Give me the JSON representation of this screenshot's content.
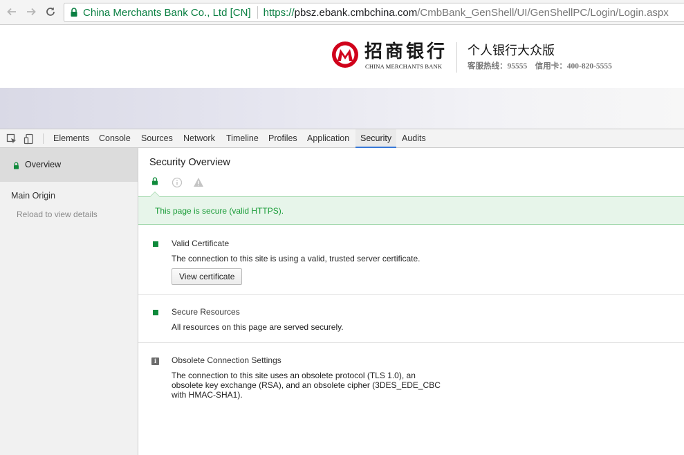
{
  "browser": {
    "nav": {
      "back_icon": "arrow-left-icon",
      "forward_icon": "arrow-right-icon",
      "reload_icon": "reload-icon"
    },
    "omnibox": {
      "ev_name": "China Merchants Bank Co., Ltd [CN]",
      "scheme": "https://",
      "host": "pbsz.ebank.cmbchina.com",
      "path": "/CmbBank_GenShell/UI/GenShellPC/Login/Login.aspx",
      "secure_color": "#0b8043"
    }
  },
  "page": {
    "logo_cn": "招商银行",
    "logo_en": "CHINA MERCHANTS BANK",
    "title": "个人银行大众版",
    "hotline": "客服热线：95555　信用卡：400-820-5555",
    "brand_color": "#d0021b"
  },
  "devtools": {
    "tabs": [
      {
        "label": "Elements"
      },
      {
        "label": "Console"
      },
      {
        "label": "Sources"
      },
      {
        "label": "Network"
      },
      {
        "label": "Timeline"
      },
      {
        "label": "Profiles"
      },
      {
        "label": "Application"
      },
      {
        "label": "Security",
        "selected": true
      },
      {
        "label": "Audits"
      }
    ],
    "sidebar": {
      "overview_label": "Overview",
      "main_origin_label": "Main Origin",
      "reload_hint": "Reload to view details"
    },
    "security": {
      "title": "Security Overview",
      "summary": "This page is secure (valid HTTPS).",
      "secure_color": "#0f8a3b",
      "sections": [
        {
          "title": "Valid Certificate",
          "description": "The connection to this site is using a valid, trusted server certificate.",
          "button": "View certificate",
          "icon": "secure-square-icon"
        },
        {
          "title": "Secure Resources",
          "description": "All resources on this page are served securely.",
          "icon": "secure-square-icon"
        },
        {
          "title": "Obsolete Connection Settings",
          "description_lines": [
            "The connection to this site uses an obsolete protocol (TLS 1.0), an",
            "obsolete key exchange (RSA), and an obsolete cipher (3DES_EDE_CBC",
            "with HMAC-SHA1)."
          ],
          "icon": "info-square-icon"
        }
      ]
    }
  }
}
